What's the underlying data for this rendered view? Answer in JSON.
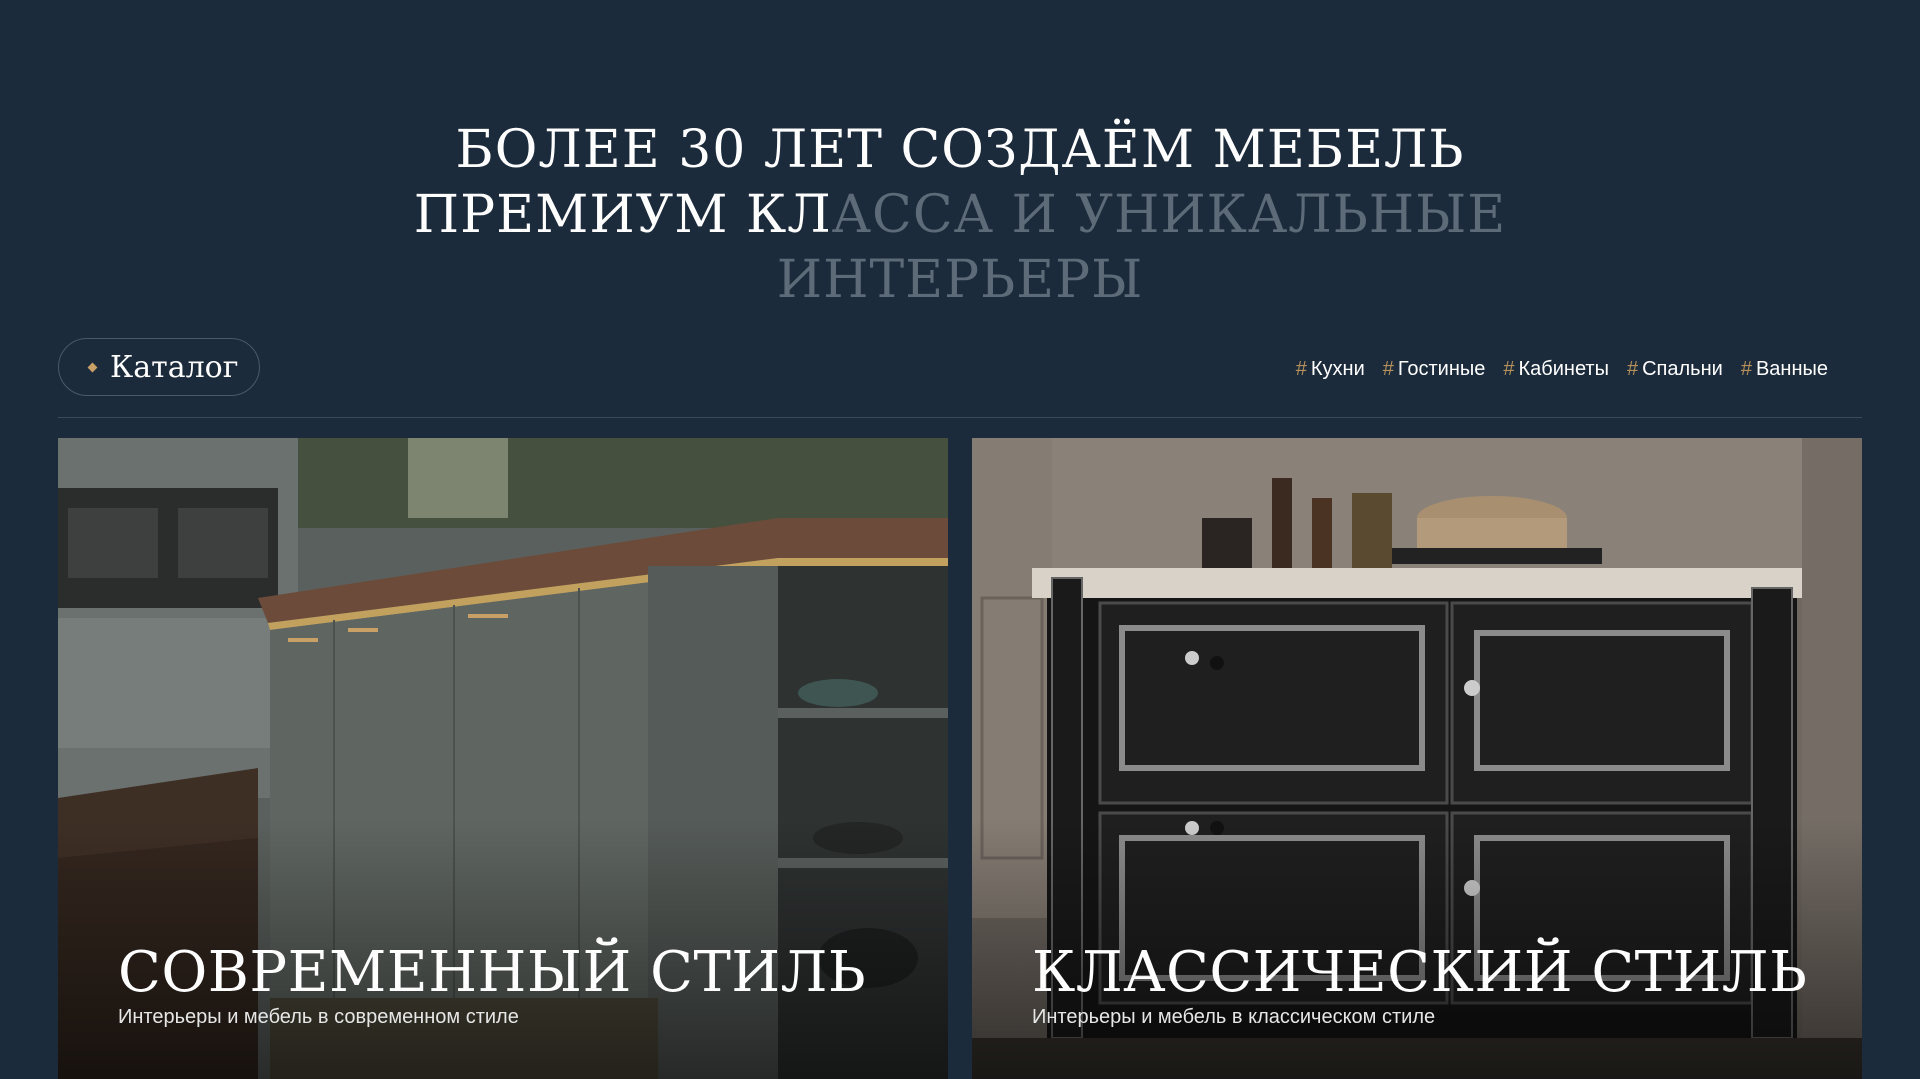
{
  "hero": {
    "line1": "БОЛЕЕ 30 ЛЕТ СОЗДАЁМ МЕБЕЛЬ",
    "line2_bright": "ПРЕМИУМ КЛ",
    "line2_dim": "АССА И УНИКАЛЬНЫЕ",
    "line3_dim": "ИНТЕРЬЕРЫ"
  },
  "catalog": {
    "label": "Каталог"
  },
  "tags": [
    {
      "hash": "#",
      "label": "Кухни"
    },
    {
      "hash": "#",
      "label": "Гостиные"
    },
    {
      "hash": "#",
      "label": "Кабинеты"
    },
    {
      "hash": "#",
      "label": "Спальни"
    },
    {
      "hash": "#",
      "label": "Ванные"
    }
  ],
  "cards": [
    {
      "title": "СОВРЕМЕННЫЙ СТИЛЬ",
      "subtitle": "Интерьеры и мебель в современном стиле"
    },
    {
      "title": "КЛАССИЧЕСКИЙ СТИЛЬ",
      "subtitle": "Интерьеры и мебель в классическом стиле"
    }
  ],
  "colors": {
    "background": "#1c2b3b",
    "accent_gold": "#c9a066",
    "dim_text": "#5d6a78"
  }
}
